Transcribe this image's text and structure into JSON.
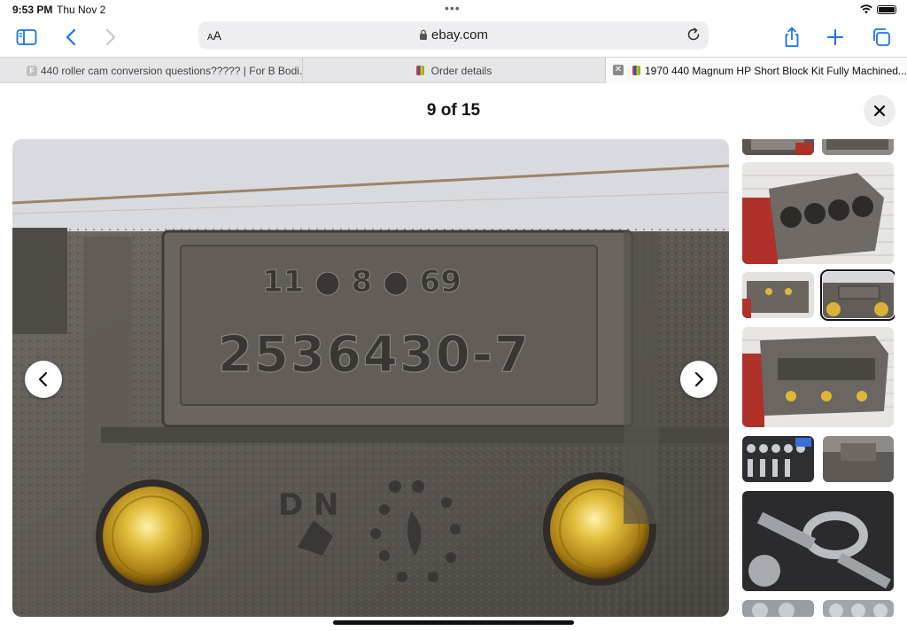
{
  "status": {
    "time": "9:53 PM",
    "date": "Thu Nov 2",
    "wifi": "wifi-icon",
    "battery": "battery-icon"
  },
  "toolbar": {
    "aa_label_small": "A",
    "aa_label": "A",
    "url": "ebay.com"
  },
  "tabs": [
    {
      "favicon": "F",
      "label": "440 roller cam conversion questions????? | For B Bodi..."
    },
    {
      "label": "Order details"
    },
    {
      "label": "1970 440 Magnum HP Short Block Kit Fully Machined..."
    }
  ],
  "viewer": {
    "counter": "9 of 15",
    "current": 9,
    "total": 15
  },
  "engraving": {
    "date_code": "11 ● 8 ● 69",
    "casting_number": "2536430-7",
    "letters": "D N"
  },
  "colors": {
    "accent": "#3b82f6",
    "brass": "#c9a227",
    "block": "#6b6661"
  }
}
